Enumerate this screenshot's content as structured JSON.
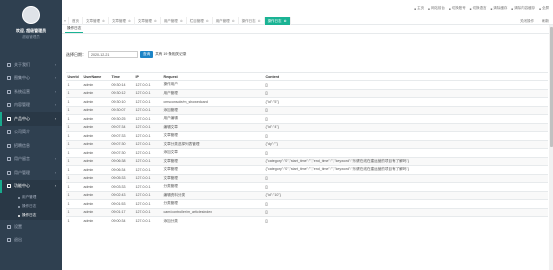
{
  "sidebar": {
    "user": {
      "name": "欢迎, 超级管理员",
      "role": "超级管理员"
    },
    "items": [
      {
        "label": "关于我们",
        "icon": "home-icon",
        "has_arrow": true
      },
      {
        "label": "图集中心",
        "icon": "picture-icon",
        "has_arrow": true
      },
      {
        "label": "系统运营",
        "icon": "desktop-icon",
        "has_arrow": true
      },
      {
        "label": "内容管理",
        "icon": "edit-icon",
        "has_arrow": true
      },
      {
        "label": "产品中心",
        "icon": "box-icon",
        "has_arrow": true,
        "active": true
      },
      {
        "label": "公司简介",
        "icon": "building-icon"
      },
      {
        "label": "招聘信息",
        "icon": "briefcase-icon"
      },
      {
        "label": "用户留言",
        "icon": "comment-icon",
        "has_arrow": true
      },
      {
        "label": "用户管理",
        "icon": "users-icon",
        "has_arrow": true
      },
      {
        "label": "功能中心",
        "icon": "cog-icon",
        "has_arrow": true,
        "active": true
      }
    ],
    "sub_items": [
      {
        "label": "用户管理"
      },
      {
        "label": "操作日志"
      },
      {
        "label": "操作日志",
        "active": true
      }
    ],
    "bottom_items": [
      {
        "label": "设置",
        "icon": "settings-icon"
      },
      {
        "label": "退出",
        "icon": "logout-icon"
      }
    ]
  },
  "topbar": {
    "toolbar": [
      "主页",
      "网站前台",
      "切换账号",
      "切换语言",
      "清除缓存",
      "清除内容缓存",
      "全屏"
    ],
    "tabs": [
      {
        "label": "首页"
      },
      {
        "label": "文章管理"
      },
      {
        "label": "文章管理"
      },
      {
        "label": "文章管理"
      },
      {
        "label": "用户管理"
      },
      {
        "label": "栏目管理"
      },
      {
        "label": "用户管理"
      },
      {
        "label": "操作日志"
      },
      {
        "label": "操作日志",
        "active": true
      }
    ],
    "right_tabs": [
      "关闭操作",
      "刷新"
    ]
  },
  "content": {
    "subtab": "操作日志",
    "query": {
      "label": "选择日期：",
      "date": "2020-12-21",
      "button": "查询",
      "count_text": "共有 19 条相关记录"
    },
    "table": {
      "headers": [
        "UserId",
        "UserName",
        "Time",
        "IP",
        "Request",
        "Content"
      ],
      "rows": [
        [
          "1",
          "admin",
          "09:30:14",
          "127.0.0.1",
          "操作用户",
          "[]"
        ],
        [
          "1",
          "admin",
          "09:30:12",
          "127.0.0.1",
          "用户管理",
          "[]"
        ],
        [
          "1",
          "admin",
          "09:30:10",
          "127.0.0.1",
          "cmsconsole/m_showedcard",
          "{\"id\":\"5\"}"
        ],
        [
          "1",
          "admin",
          "09:30:07",
          "127.0.0.1",
          "添加管理",
          "[]"
        ],
        [
          "1",
          "admin",
          "09:30:25",
          "127.0.0.1",
          "用户编辑",
          "[]"
        ],
        [
          "1",
          "admin",
          "09:07:34",
          "127.0.0.1",
          "编辑文章",
          "{\"id\":\"4\"}"
        ],
        [
          "1",
          "admin",
          "09:07:33",
          "127.0.0.1",
          "文章管理",
          "[]"
        ],
        [
          "1",
          "admin",
          "09:07:30",
          "127.0.0.1",
          "文章分类选择列表管理",
          "{\"dy\":\"\"}"
        ],
        [
          "1",
          "admin",
          "09:07:30",
          "127.0.0.1",
          "添加文章",
          "[]"
        ],
        [
          "1",
          "admin",
          "09:06:38",
          "127.0.0.1",
          "文章管理",
          "{\"category\":\"0\",\"start_time\":\"\",\"end_time\":\"\",\"keyword\":\"乐健在线在建运营的项目有了解吗\"}"
        ],
        [
          "1",
          "admin",
          "09:06:34",
          "127.0.0.1",
          "文章管理",
          "{\"category\":\"0\",\"start_time\":\"\",\"end_time\":\"\",\"keyword\":\"乐健在线在建运营的项目有了解吗\"}"
        ],
        [
          "1",
          "admin",
          "09:05:33",
          "127.0.0.1",
          "文章管理",
          "[]"
        ],
        [
          "1",
          "admin",
          "09:03:33",
          "127.0.0.1",
          "分类管理",
          "[]"
        ],
        [
          "1",
          "admin",
          "09:02:43",
          "127.0.0.1",
          "编辑资料分类",
          "{\"id\":\"10\"}"
        ],
        [
          "1",
          "admin",
          "09:01:53",
          "127.0.0.1",
          "分类管理",
          "[]"
        ],
        [
          "1",
          "admin",
          "09:01:17",
          "127.0.0.1",
          "cam/controller/m_articlesindex",
          "[]"
        ],
        [
          "1",
          "admin",
          "09:00:34",
          "127.0.0.1",
          "添加分类",
          "[]"
        ]
      ]
    }
  },
  "colors": {
    "sidebar_bg": "#2f4050",
    "accent": "#1ab394",
    "query_button": "#1c84c6"
  }
}
